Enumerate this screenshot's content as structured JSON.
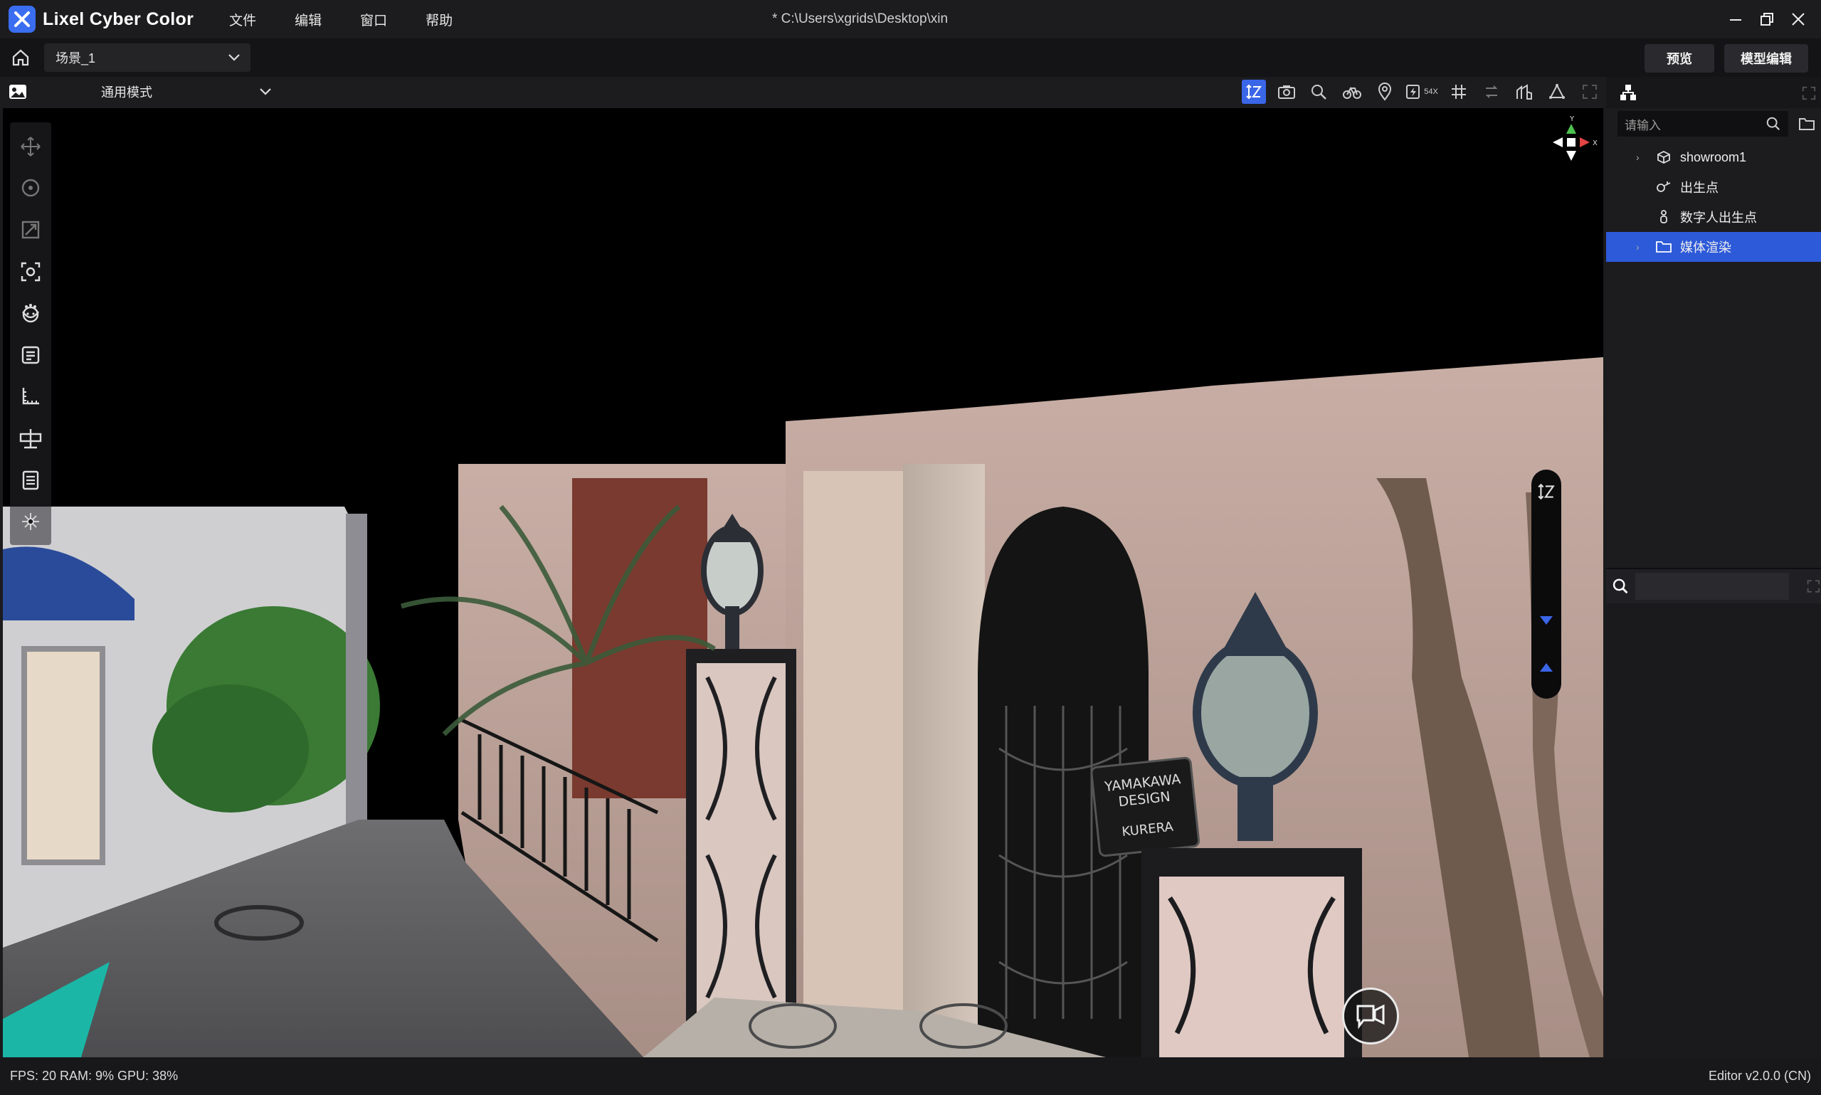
{
  "app": {
    "title": "Lixel Cyber Color",
    "file_path": "* C:\\Users\\xgrids\\Desktop\\xin"
  },
  "menu": [
    {
      "label": "文件"
    },
    {
      "label": "编辑"
    },
    {
      "label": "窗口"
    },
    {
      "label": "帮助"
    }
  ],
  "scene": {
    "selected": "场景_1"
  },
  "buttons": {
    "preview": "预览",
    "model_edit": "模型编辑"
  },
  "mode": {
    "selected": "通用模式"
  },
  "toolbar": {
    "speed_label": "54X"
  },
  "outline": {
    "search_placeholder": "请输入",
    "items": [
      {
        "label": "showroom1",
        "icon": "cube-icon",
        "expandable": true,
        "selected": false
      },
      {
        "label": "出生点",
        "icon": "spawn-point-icon",
        "expandable": false,
        "selected": false
      },
      {
        "label": "数字人出生点",
        "icon": "avatar-spawn-icon",
        "expandable": false,
        "selected": false
      },
      {
        "label": "媒体渲染",
        "icon": "folder-icon",
        "expandable": true,
        "selected": true
      }
    ]
  },
  "gizmo": {
    "y": "Y",
    "x": "X"
  },
  "status": {
    "left": "FPS: 20  RAM: 9%  GPU: 38%",
    "version": "Editor v2.0.0 (CN)"
  },
  "colors": {
    "accent": "#3a66e8",
    "selected_row": "#2d5ad9",
    "background": "#1b1b1d"
  }
}
